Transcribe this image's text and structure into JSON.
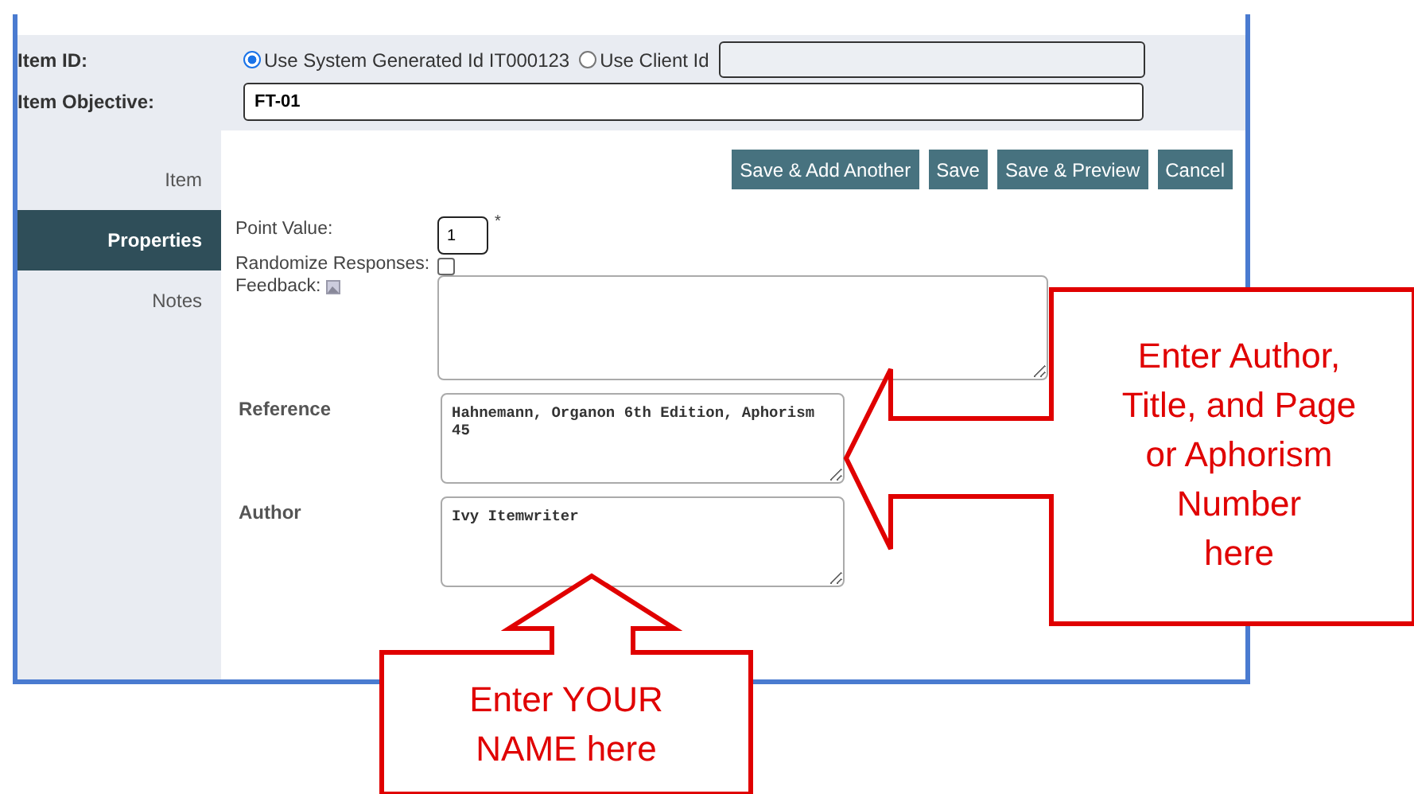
{
  "item_id": {
    "label": "Item ID:",
    "options": [
      {
        "label": "Use System Generated Id IT000123",
        "selected": true
      },
      {
        "label": "Use Client Id",
        "selected": false
      }
    ],
    "client_id_disabled": true
  },
  "item_objective": {
    "label": "Item Objective:",
    "value": "FT-01"
  },
  "sidebar": {
    "items": [
      {
        "label": "Item",
        "selected": false
      },
      {
        "label": "Properties",
        "selected": true
      },
      {
        "label": "Notes",
        "selected": false
      }
    ]
  },
  "buttons": [
    "Save & Add Another",
    "Save",
    "Save & Preview",
    "Cancel"
  ],
  "point_value": {
    "label": "Point Value:",
    "value": "1",
    "required_mark": "*"
  },
  "randomize": {
    "label": "Randomize Responses:",
    "checked": false
  },
  "feedback": {
    "label": "Feedback:"
  },
  "reference": {
    "label": "Reference",
    "value": "Hahnemann, Organon 6th Edition, Aphorism 45"
  },
  "author": {
    "label": "Author",
    "value": "Ivy Itemwriter"
  },
  "callouts": [
    {
      "kind": "left",
      "text": "Enter Author,\nTitle, and Page\nor Aphorism\nNumber\nhere"
    },
    {
      "kind": "up",
      "text": "Enter YOUR\nNAME here"
    }
  ]
}
